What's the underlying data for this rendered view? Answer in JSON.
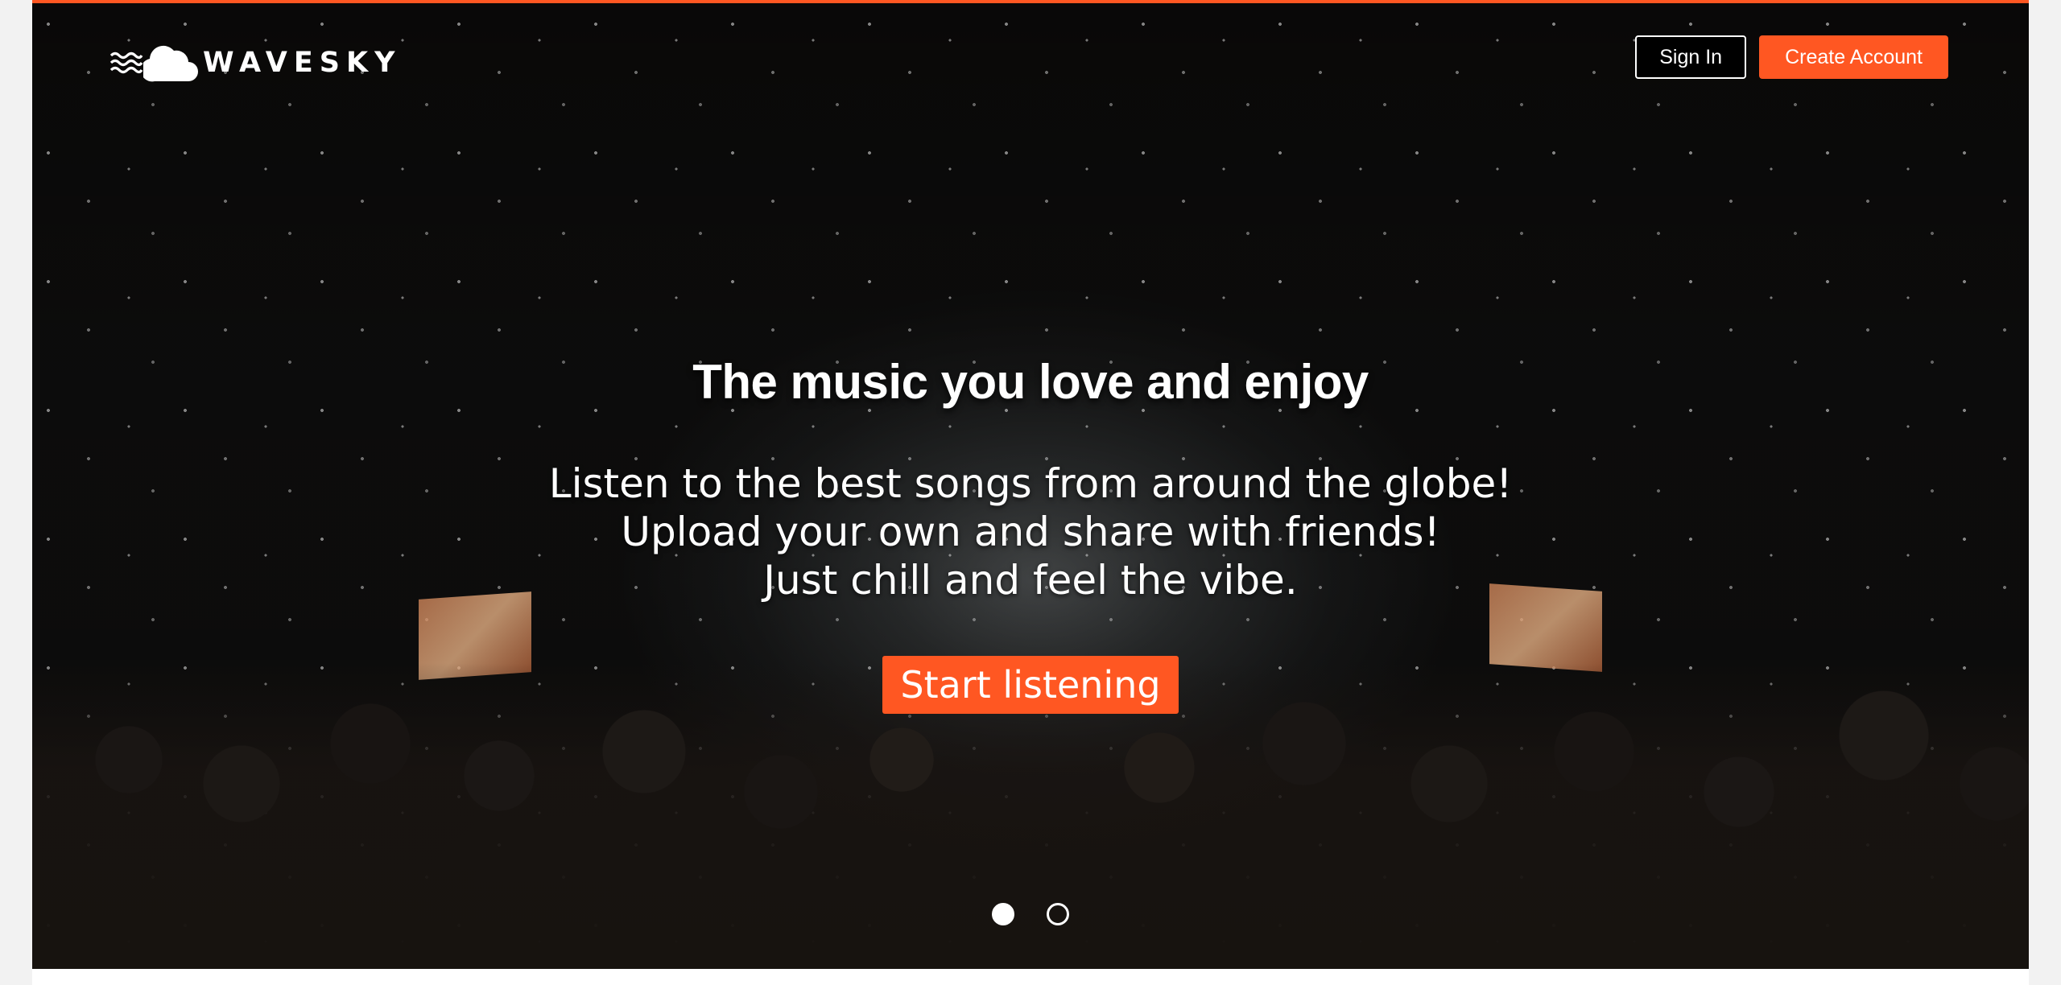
{
  "brand": {
    "name": "WAVESKY",
    "accent_color": "#ff5722",
    "logo_icons": [
      "waves-icon",
      "cloud-icon"
    ]
  },
  "nav": {
    "sign_in_label": "Sign In",
    "create_account_label": "Create Account"
  },
  "hero": {
    "title": "The music you love and enjoy",
    "lines": [
      "Listen to the best songs from around the globe!",
      "Upload your own and share with friends!",
      "Just chill and feel the vibe."
    ],
    "cta_label": "Start listening",
    "background": "concert crowd with confetti photo"
  },
  "carousel": {
    "slides": 2,
    "active_index": 0
  }
}
